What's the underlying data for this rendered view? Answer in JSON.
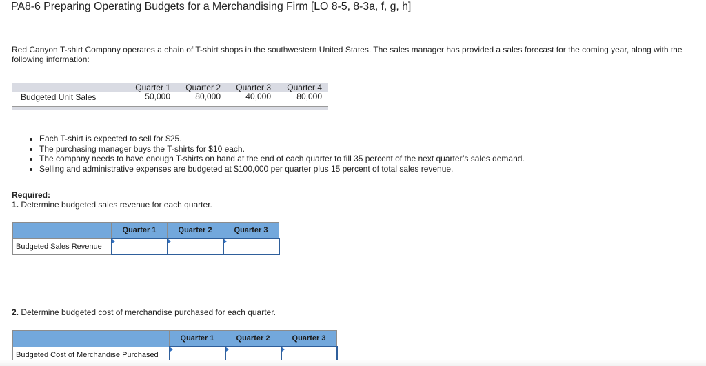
{
  "title": "PA8-6 Preparing Operating Budgets for a Merchandising Firm [LO 8-5, 8-3a, f, g, h]",
  "intro": "Red Canyon T-shirt Company operates a chain of T-shirt shops in the southwestern United States. The sales manager has provided a sales forecast for the coming year, along with the following information:",
  "info_table": {
    "columns": [
      "Quarter 1",
      "Quarter 2",
      "Quarter 3",
      "Quarter 4"
    ],
    "row_label": "Budgeted Unit Sales",
    "values": [
      "50,000",
      "80,000",
      "40,000",
      "80,000"
    ]
  },
  "bullets": [
    "Each T-shirt is expected to sell for $25.",
    "The purchasing manager buys the T-shirts for $10 each.",
    "The company needs to have enough T-shirts on hand at the end of each quarter to fill 35 percent of the next quarter’s sales demand.",
    "Selling and administrative expenses are budgeted at $100,000 per quarter plus 15 percent of total sales revenue."
  ],
  "required_label": "Required:",
  "req1": {
    "number": "1.",
    "text": " Determine budgeted sales revenue for each quarter.",
    "table": {
      "columns": [
        "Quarter 1",
        "Quarter 2",
        "Quarter 3"
      ],
      "row_label": "Budgeted Sales Revenue",
      "values": [
        "",
        "",
        ""
      ]
    }
  },
  "req2": {
    "number": "2.",
    "text": " Determine budgeted cost of merchandise purchased for each quarter.",
    "table": {
      "columns": [
        "Quarter 1",
        "Quarter 2",
        "Quarter 3"
      ],
      "row_label": "Budgeted Cost of Merchandise Purchased",
      "values": [
        "",
        "",
        ""
      ]
    }
  },
  "colors": {
    "header_blue": "#73a8dc",
    "input_border": "#2f5f9b",
    "info_header_gray": "#d9dbe3"
  }
}
